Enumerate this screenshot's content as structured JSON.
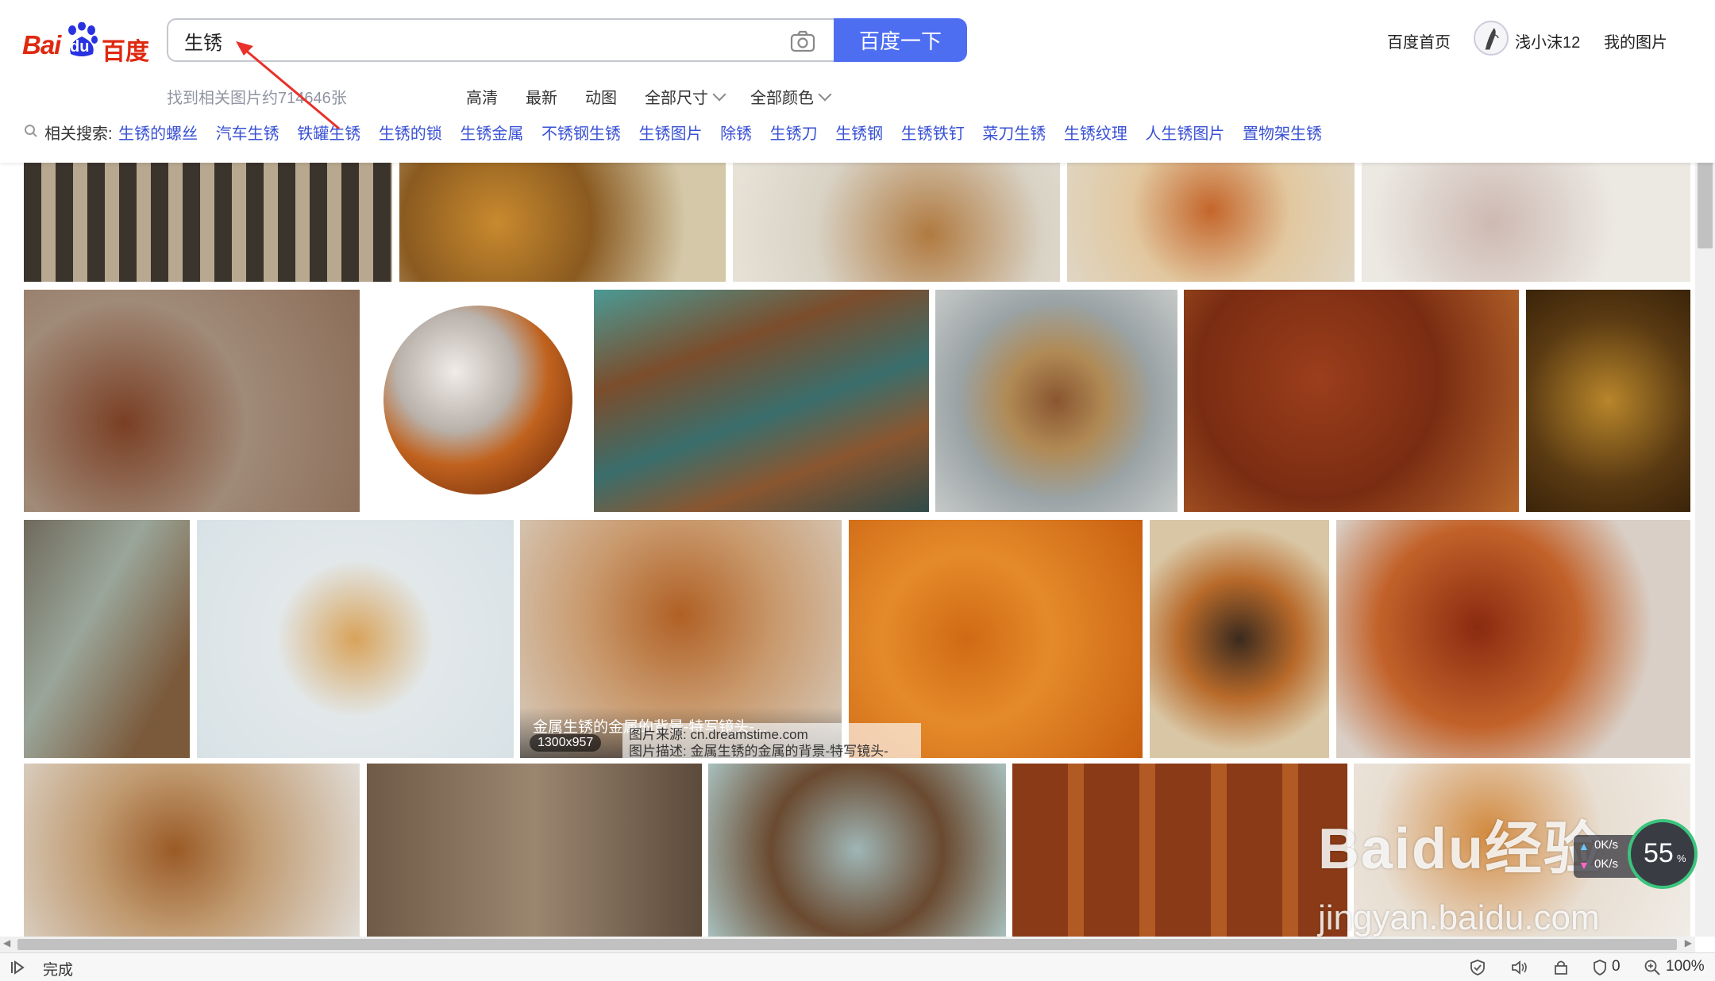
{
  "header": {
    "logo_text": "Bai du 百度",
    "logo_bai": "Bai",
    "logo_du": "du",
    "logo_cn": "百度",
    "search_value": "生锈",
    "search_button": "百度一下",
    "result_count": "找到相关图片约714646张",
    "filters": [
      "高清",
      "最新",
      "动图",
      "全部尺寸",
      "全部颜色"
    ],
    "top_links": {
      "home": "百度首页",
      "user": "浅小沫12",
      "my_images": "我的图片"
    }
  },
  "related": {
    "label": "相关搜索:",
    "items": [
      "生锈的螺丝",
      "汽车生锈",
      "铁罐生锈",
      "生锈的锁",
      "生锈金属",
      "不锈钢生锈",
      "生锈图片",
      "除锈",
      "生锈刀",
      "生锈钢",
      "生锈铁钉",
      "菜刀生锈",
      "生锈纹理",
      "人生锈图片",
      "置物架生锈"
    ]
  },
  "hovered_tile": {
    "caption": "金属生锈的金属的背景-特写镜头-...",
    "size": "1300x957",
    "source": "图片来源: cn.dreamstime.com",
    "description": "图片描述: 金属生锈的金属的背景-特写镜头-"
  },
  "watermark": {
    "brand": "Baidu经验",
    "url": "jingyan.baidu.com"
  },
  "speed_widget": {
    "percent": "55",
    "up": "0K/s",
    "down": "0K/s"
  },
  "statusbar": {
    "status": "完成",
    "shield_count": "0",
    "zoom": "100%"
  },
  "colors": {
    "brand_red": "#de2910",
    "brand_blue": "#4e6ef2",
    "link_blue": "#3951d4"
  }
}
